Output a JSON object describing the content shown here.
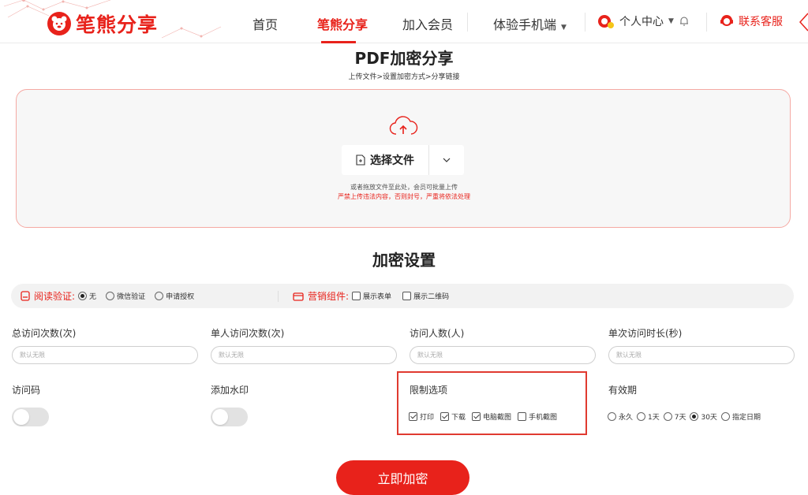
{
  "header": {
    "logo_text": "笔熊分享",
    "nav": [
      "首页",
      "笔熊分享",
      "加入会员",
      "体验手机端"
    ],
    "user_center": "个人中心",
    "contact": "联系客服"
  },
  "page": {
    "title": "PDF加密分享",
    "steps": "上传文件>设置加密方式>分享链接"
  },
  "upload": {
    "choose_label": "选择文件",
    "hint": "或者拖放文件至此处，会员可批量上传",
    "warning": "严禁上传违法内容，否则封号，严重将依法处理"
  },
  "settings": {
    "title": "加密设置",
    "read_verify": {
      "label": "阅读验证:",
      "options": [
        "无",
        "微信验证",
        "申请授权"
      ],
      "selected": "无"
    },
    "marketing": {
      "label": "营销组件:",
      "options": [
        "展示表单",
        "展示二维码"
      ]
    },
    "fields": [
      {
        "label": "总访问次数(次)",
        "placeholder": "默认无限"
      },
      {
        "label": "单人访问次数(次)",
        "placeholder": "默认无限"
      },
      {
        "label": "访问人数(人)",
        "placeholder": "默认无限"
      },
      {
        "label": "单次访问时长(秒)",
        "placeholder": "默认无限"
      }
    ],
    "access_code": {
      "label": "访问码",
      "enabled": false
    },
    "watermark": {
      "label": "添加水印",
      "enabled": false
    },
    "restrict": {
      "label": "限制选项",
      "options": [
        {
          "label": "打印",
          "checked": true
        },
        {
          "label": "下载",
          "checked": true
        },
        {
          "label": "电脑截图",
          "checked": true
        },
        {
          "label": "手机截图",
          "checked": false
        }
      ]
    },
    "validity": {
      "label": "有效期",
      "options": [
        "永久",
        "1天",
        "7天",
        "30天",
        "指定日期"
      ],
      "selected": "30天"
    },
    "submit": "立即加密"
  },
  "colors": {
    "brand": "#e8221b",
    "highlight_box": "#e03a30"
  }
}
